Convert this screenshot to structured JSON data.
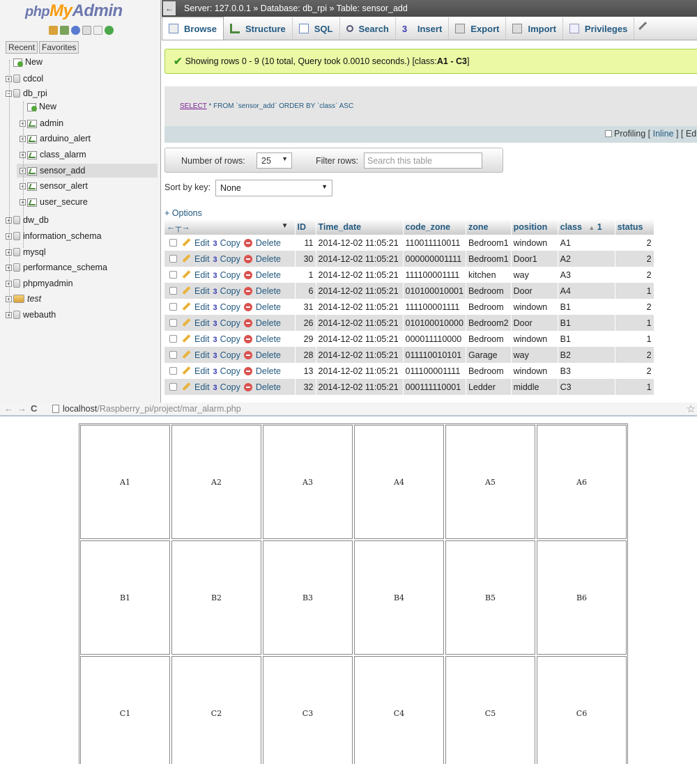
{
  "nav": {
    "logo_php": "php",
    "logo_my": "My",
    "logo_admin": "Admin",
    "tabs": [
      "Recent",
      "Favorites"
    ],
    "tree": [
      {
        "label": "New",
        "kind": "new",
        "level": 0
      },
      {
        "label": "cdcol",
        "kind": "db",
        "level": 0
      },
      {
        "label": "db_rpi",
        "kind": "db",
        "level": 0,
        "expanded": true
      },
      {
        "label": "New",
        "kind": "new",
        "level": 1
      },
      {
        "label": "admin",
        "kind": "table",
        "level": 1
      },
      {
        "label": "arduino_alert",
        "kind": "table",
        "level": 1
      },
      {
        "label": "class_alarm",
        "kind": "table",
        "level": 1
      },
      {
        "label": "sensor_add",
        "kind": "table",
        "level": 1,
        "selected": true
      },
      {
        "label": "sensor_alert",
        "kind": "table",
        "level": 1
      },
      {
        "label": "user_secure",
        "kind": "table",
        "level": 1
      },
      {
        "label": "dw_db",
        "kind": "db",
        "level": 0
      },
      {
        "label": "information_schema",
        "kind": "db",
        "level": 0
      },
      {
        "label": "mysql",
        "kind": "db",
        "level": 0
      },
      {
        "label": "performance_schema",
        "kind": "db",
        "level": 0
      },
      {
        "label": "phpmyadmin",
        "kind": "db",
        "level": 0
      },
      {
        "label": "test",
        "kind": "db-italic",
        "level": 0
      },
      {
        "label": "webauth",
        "kind": "db",
        "level": 0
      }
    ]
  },
  "breadcrumb": "Server: 127.0.0.1 » Database: db_rpi » Table: sensor_add",
  "tabs": [
    "Browse",
    "Structure",
    "SQL",
    "Search",
    "Insert",
    "Export",
    "Import",
    "Privileges"
  ],
  "message": {
    "text": "Showing rows 0 - 9 (10 total, Query took 0.0010 seconds.) [class: ",
    "bold": "A1 - C3",
    "tail": "]"
  },
  "query": {
    "keyword": "SELECT",
    "rest": " * FROM `sensor_add` ORDER BY `class` ASC"
  },
  "profiling": {
    "label": "Profiling [",
    "inline": "Inline",
    "tail": "] [ Ed"
  },
  "rows_nav": {
    "num_rows_label": "Number of rows:",
    "num_rows_value": "25",
    "filter_label": "Filter rows:",
    "filter_placeholder": "Search this table"
  },
  "sort": {
    "label": "Sort by key:",
    "value": "None"
  },
  "options_label": "+ Options",
  "table": {
    "headers": [
      "ID",
      "Time_date",
      "code_zone",
      "zone",
      "position",
      "class",
      "status"
    ],
    "sort_indicator": "1",
    "actions": {
      "edit": "Edit",
      "copy": "Copy",
      "delete": "Delete"
    },
    "rows": [
      [
        "11",
        "2014-12-02 11:05:21",
        "110011110011",
        "Bedroom1",
        "windown",
        "A1",
        "2"
      ],
      [
        "30",
        "2014-12-02 11:05:21",
        "000000001111",
        "Bedroom1",
        "Door1",
        "A2",
        "2"
      ],
      [
        "1",
        "2014-12-02 11:05:21",
        "111100001111",
        "kitchen",
        "way",
        "A3",
        "2"
      ],
      [
        "6",
        "2014-12-02 11:05:21",
        "010100010001",
        "Bedroom",
        "Door",
        "A4",
        "1"
      ],
      [
        "31",
        "2014-12-02 11:05:21",
        "111100001111",
        "Bedroom",
        "windown",
        "B1",
        "2"
      ],
      [
        "26",
        "2014-12-02 11:05:21",
        "010100010000",
        "Bedroom2",
        "Door",
        "B1",
        "1"
      ],
      [
        "29",
        "2014-12-02 11:05:21",
        "000011110000",
        "Bedroom",
        "windown",
        "B1",
        "1"
      ],
      [
        "28",
        "2014-12-02 11:05:21",
        "011110010101",
        "Garage",
        "way",
        "B2",
        "2"
      ],
      [
        "13",
        "2014-12-02 11:05:21",
        "011100001111",
        "Bedroom",
        "windown",
        "B3",
        "2"
      ],
      [
        "32",
        "2014-12-02 11:05:21",
        "000111110001",
        "Ledder",
        "middle",
        "C3",
        "1"
      ]
    ]
  },
  "browser": {
    "url_host": "localhost",
    "url_path": "/Raspberry_pi/project/mar_alarm.php",
    "cells": [
      "A1",
      "A2",
      "A3",
      "A4",
      "A5",
      "A6",
      "B1",
      "B2",
      "B3",
      "B4",
      "B5",
      "B6",
      "C1",
      "C2",
      "C3",
      "C4",
      "C5",
      "C6"
    ]
  },
  "colors": {
    "link": "#235a81",
    "logo_orange": "#f89c0e",
    "logo_blue": "#6c78af",
    "success_bg": "#ebf8a4"
  }
}
